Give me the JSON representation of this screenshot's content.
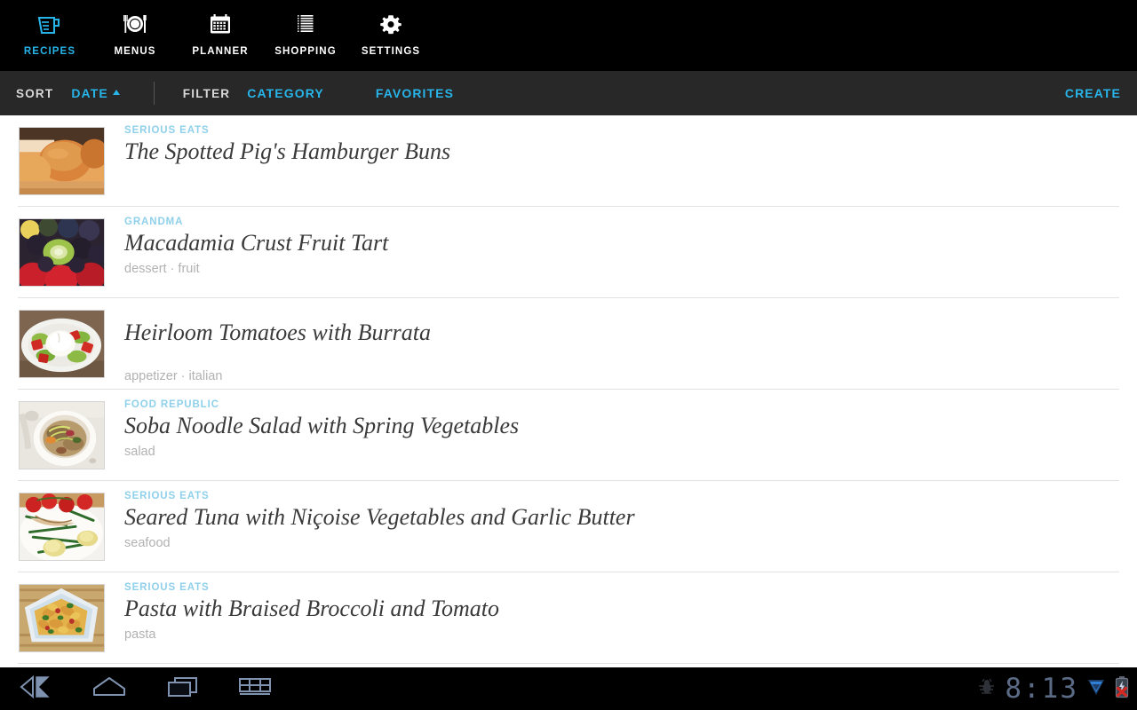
{
  "topnav": {
    "items": [
      {
        "label": "RECIPES",
        "icon": "measuring-cup-icon",
        "active": true
      },
      {
        "label": "MENUS",
        "icon": "plate-cutlery-icon",
        "active": false
      },
      {
        "label": "PLANNER",
        "icon": "calendar-icon",
        "active": false
      },
      {
        "label": "SHOPPING",
        "icon": "list-lines-icon",
        "active": false
      },
      {
        "label": "SETTINGS",
        "icon": "gear-icon",
        "active": false
      }
    ],
    "active_color": "#27b4e8",
    "background": "#000000"
  },
  "toolbar": {
    "sort_label": "SORT",
    "sort_value": "DATE",
    "sort_direction": "ascending",
    "filter_label": "FILTER",
    "filter_category": "CATEGORY",
    "filter_favorites": "FAVORITES",
    "create_label": "CREATE",
    "accent_color": "#27b4e8",
    "background": "#282828"
  },
  "recipes": [
    {
      "source": "SERIOUS EATS",
      "title": "The Spotted Pig's Hamburger Buns",
      "tags": "",
      "thumb": "hamburger-buns-photo"
    },
    {
      "source": "GRANDMA",
      "title": "Macadamia Crust Fruit Tart",
      "tags": "dessert · fruit",
      "thumb": "fruit-tart-photo"
    },
    {
      "source": "",
      "title": "Heirloom Tomatoes with Burrata",
      "tags": "appetizer · italian",
      "thumb": "tomatoes-burrata-photo"
    },
    {
      "source": "FOOD REPUBLIC",
      "title": "Soba Noodle Salad with Spring Vegetables",
      "tags": "salad",
      "thumb": "soba-noodle-salad-photo"
    },
    {
      "source": "SERIOUS EATS",
      "title": "Seared Tuna with Niçoise Vegetables and Garlic Butter",
      "tags": "seafood",
      "thumb": "seared-tuna-photo"
    },
    {
      "source": "SERIOUS EATS",
      "title": "Pasta with Braised Broccoli and Tomato",
      "tags": "pasta",
      "thumb": "pasta-broccoli-photo"
    }
  ],
  "list_style": {
    "source_color": "#8fd0ea",
    "title_color": "#3a3a3a",
    "tag_color": "#b2b2b2",
    "divider_color": "#e2e2e2"
  },
  "systembar": {
    "back_icon": "back-arrow-icon",
    "home_icon": "home-icon",
    "recents_icon": "recent-apps-icon",
    "keyboard_icon": "keyboard-icon",
    "debug_icon": "bug-icon",
    "signal_icon": "signal-triangle-icon",
    "battery_icon": "battery-error-icon",
    "clock": "8:13",
    "clock_color": "#5b6b86",
    "background": "#000000"
  }
}
